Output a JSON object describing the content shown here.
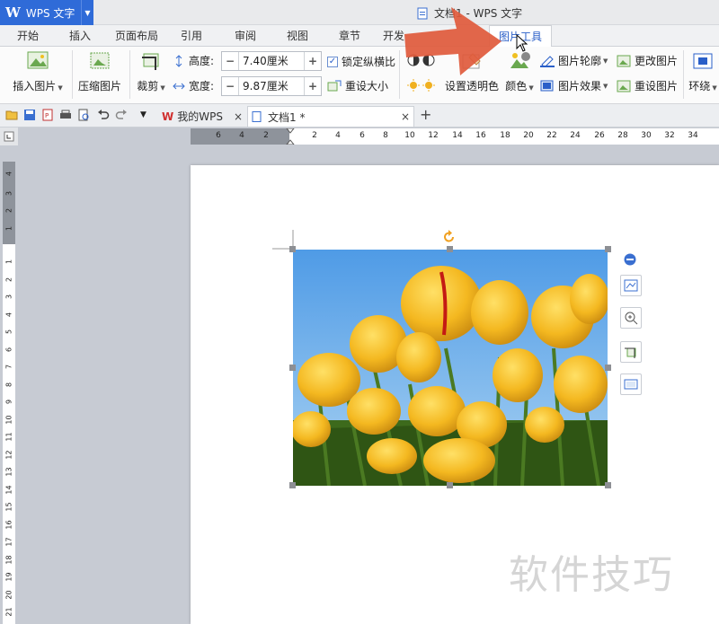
{
  "app": {
    "logo": "W",
    "name": "WPS 文字",
    "doc_title": "文档1 - WPS 文字"
  },
  "tabs": [
    "开始",
    "插入",
    "页面布局",
    "引用",
    "审阅",
    "视图",
    "章节",
    "开发",
    "图片工具"
  ],
  "active_tab": "图片工具",
  "ribbon": {
    "insert_picture": "插入图片",
    "compress_picture": "压缩图片",
    "crop": "裁剪",
    "height_label": "高度:",
    "height_value": "7.40厘米",
    "width_label": "宽度:",
    "width_value": "9.87厘米",
    "lock_ratio": "锁定纵横比",
    "reset_size": "重设大小",
    "set_transparent": "设置透明色",
    "color": "颜色",
    "picture_outline": "图片轮廓",
    "picture_effects": "图片效果",
    "change_picture": "更改图片",
    "reset_picture": "重设图片",
    "wrap": "环绕"
  },
  "doc_tabs": [
    {
      "label": "我的WPS",
      "active": false
    },
    {
      "label": "文档1 *",
      "active": true
    }
  ],
  "hruler_ticks": [
    "6",
    "4",
    "2",
    "2",
    "4",
    "6",
    "8",
    "10",
    "12",
    "14",
    "16",
    "18",
    "20",
    "22",
    "24",
    "26",
    "28",
    "30",
    "32",
    "34"
  ],
  "vruler_ticks": [
    "4",
    "3",
    "2",
    "1",
    "1",
    "2",
    "3",
    "4",
    "5",
    "6",
    "7",
    "8",
    "9",
    "10",
    "11",
    "12",
    "13",
    "14",
    "15",
    "16",
    "17",
    "18",
    "19",
    "20",
    "21"
  ],
  "watermark": "软件技巧",
  "colors": {
    "app_blue": "#2f6bd8",
    "active_tab_text": "#2a5fc8",
    "arrow": "#e05a3c"
  }
}
